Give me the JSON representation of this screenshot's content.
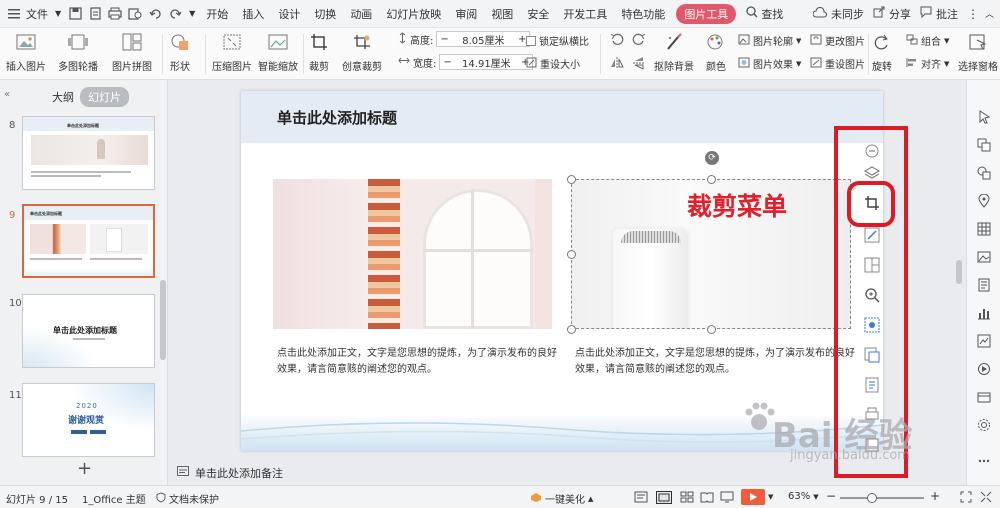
{
  "menu": {
    "file_label": "文件",
    "tabs": [
      "开始",
      "插入",
      "设计",
      "切换",
      "动画",
      "幻灯片放映",
      "审阅",
      "视图",
      "安全",
      "开发工具",
      "特色功能"
    ],
    "active_tab": "图片工具",
    "search_label": "查找",
    "sync_label": "未同步",
    "share_label": "分享",
    "comment_label": "批注"
  },
  "ribbon": {
    "insert_picture": "插入图片",
    "multi_outline": "多图轮播",
    "puzzle": "图片拼图",
    "shape": "形状",
    "compress": "压缩图片",
    "smart_zoom": "智能缩放",
    "crop": "裁剪",
    "creative_crop": "创意裁剪",
    "height_label": "高度:",
    "height_value": "8.05厘米",
    "width_label": "宽度:",
    "width_value": "14.91厘米",
    "lock_ratio": "锁定纵横比",
    "reset_size": "重设大小",
    "remove_bg": "抠除背景",
    "color": "颜色",
    "picture_outline": "图片轮廓",
    "change_picture": "更改图片",
    "picture_effect": "图片效果",
    "reset_picture": "重设图片",
    "rotate": "旋转",
    "group": "组合",
    "align": "对齐",
    "select_pane": "选择窗格"
  },
  "left_panel": {
    "tab_outline": "大纲",
    "tab_slides": "幻灯片",
    "slides": [
      {
        "num": "8",
        "title": "单击此处添加标题"
      },
      {
        "num": "9",
        "title": "单击此处添加标题"
      },
      {
        "num": "10",
        "title": "单击此处添加标题"
      },
      {
        "num": "11",
        "year": "2020",
        "title": "谢谢观赏"
      }
    ],
    "add_symbol": "+"
  },
  "slide": {
    "title": "单击此处添加标题",
    "text_left": "点击此处添加正文，文字是您思想的提炼，为了演示发布的良好效果，请言简意赅的阐述您的观点。",
    "text_right": "点击此处添加正文，文字是您思想的提炼，为了演示发布的良好效果，请言简意赅的阐述您的观点。"
  },
  "annotation": "裁剪菜单",
  "notes_placeholder": "单击此处添加备注",
  "status": {
    "slide_counter": "幻灯片 9 / 15",
    "theme": "1_Office 主题",
    "protect": "文档未保护",
    "beautify": "一键美化",
    "zoom": "63%"
  },
  "watermark": {
    "line1": "Bai 经验",
    "line2": "jingyan.baidu.com"
  },
  "colors": {
    "accent_tab": "#e0586b",
    "annotation_red": "#dd1b24",
    "play_button": "#f25c3b",
    "selected_thumb_border": "#d9683e"
  }
}
